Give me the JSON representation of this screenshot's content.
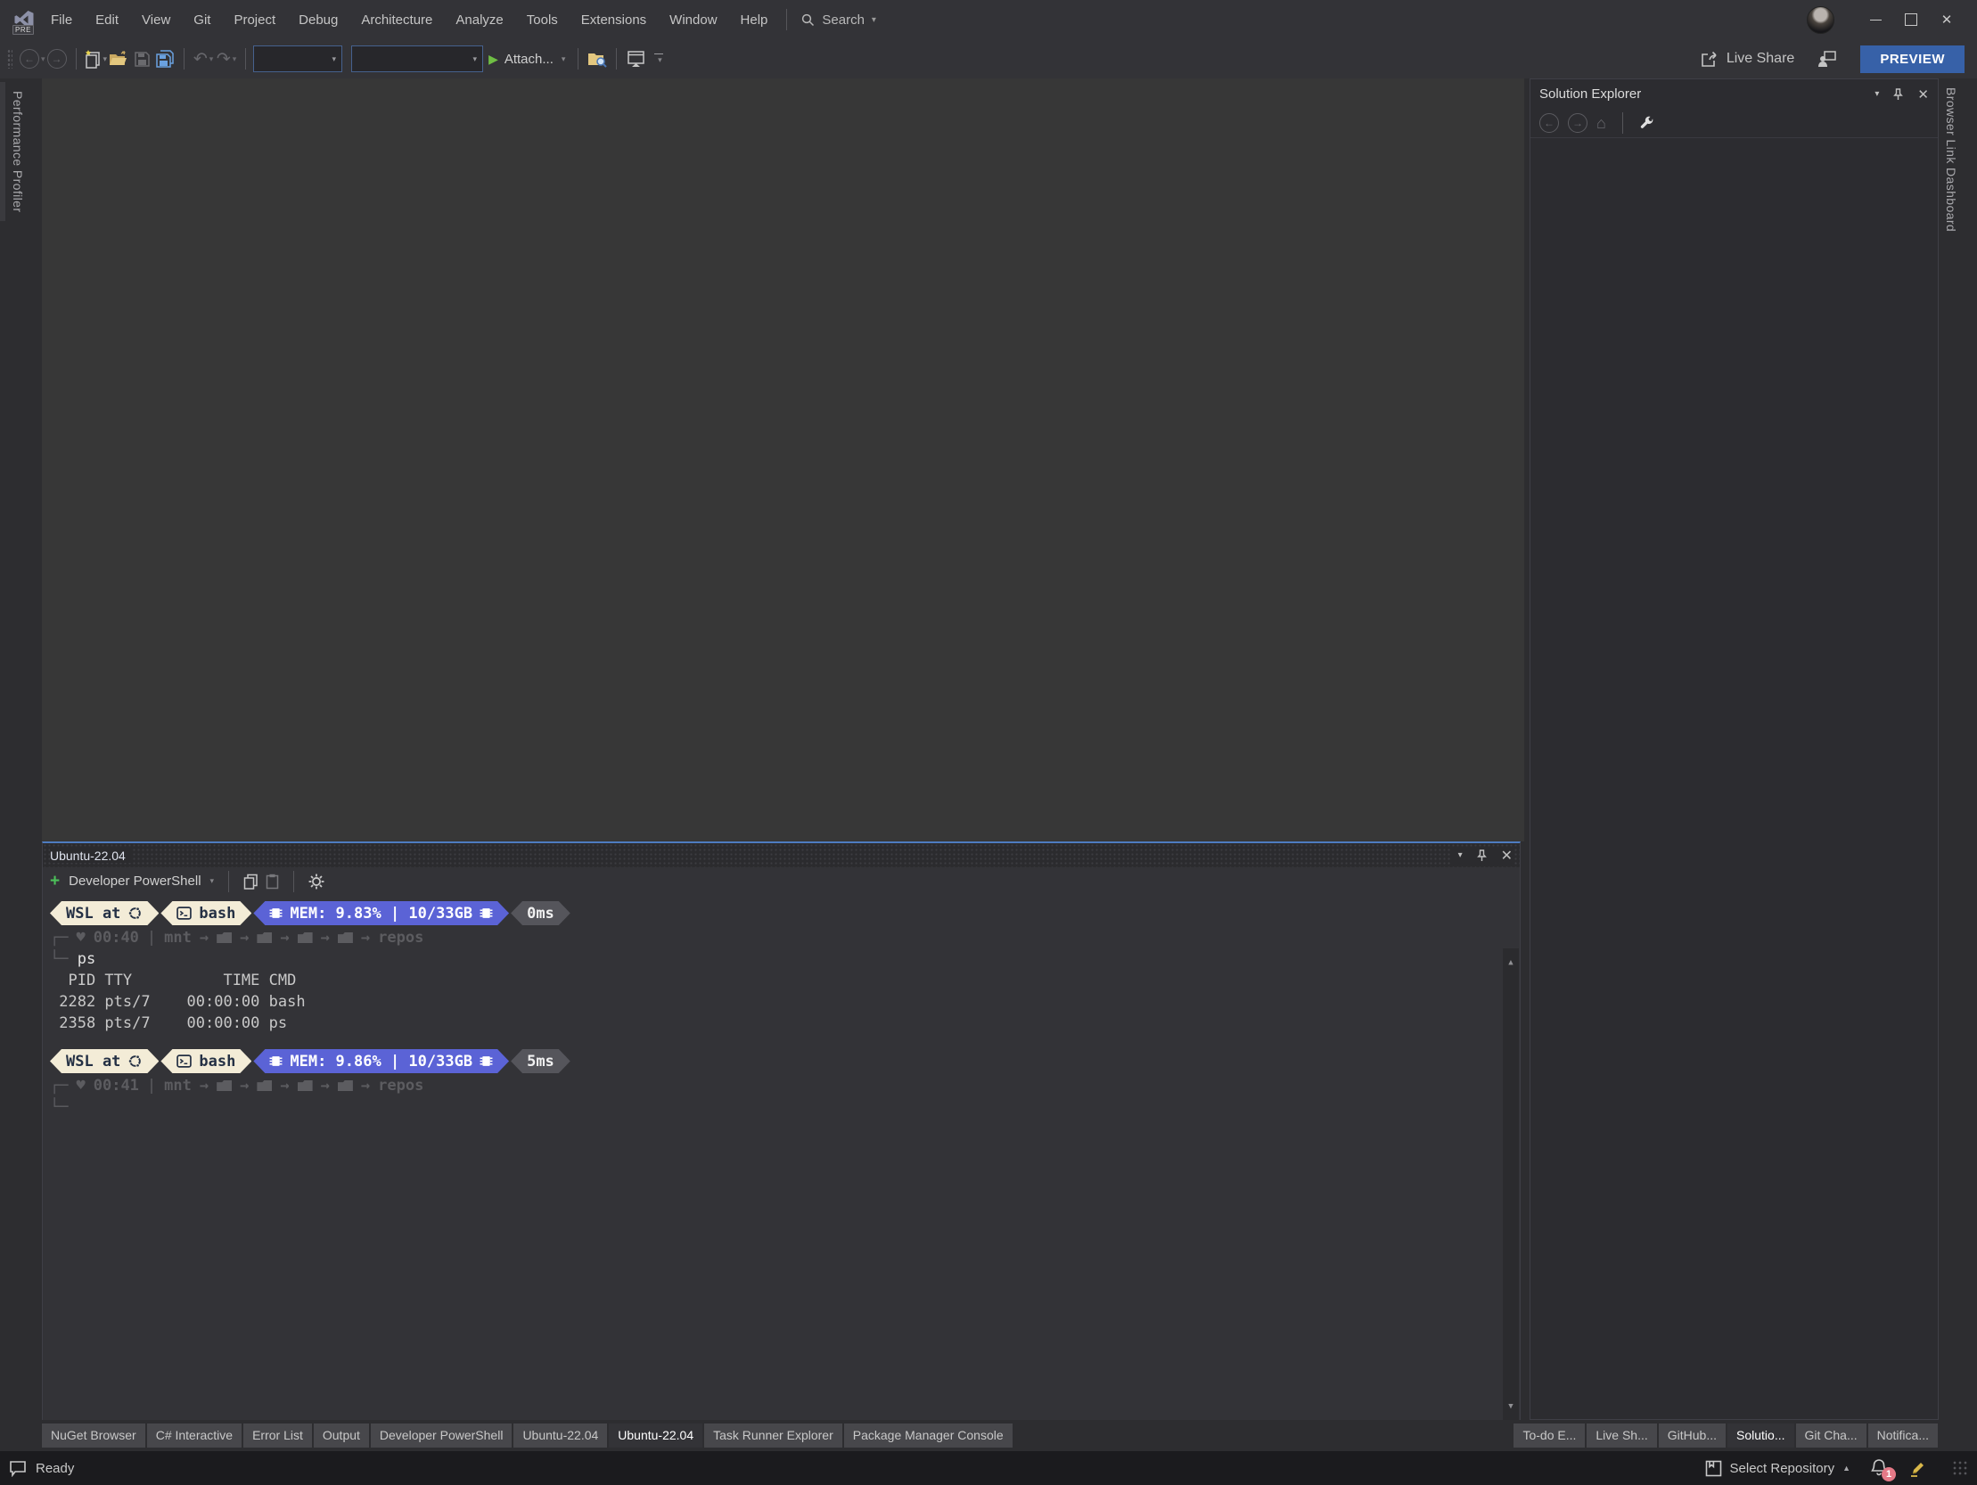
{
  "window": {
    "logo_badge": "PRE"
  },
  "menu": {
    "items": [
      "File",
      "Edit",
      "View",
      "Git",
      "Project",
      "Debug",
      "Architecture",
      "Analyze",
      "Tools",
      "Extensions",
      "Window",
      "Help"
    ],
    "search_label": "Search"
  },
  "toolbar": {
    "attach_label": "Attach..."
  },
  "titlebar_right": {
    "live_share_label": "Live Share",
    "preview_button": "PREVIEW"
  },
  "left_strip": {
    "tab_label": "Performance Profiler"
  },
  "right_strip": {
    "tab_label": "Browser Link Dashboard"
  },
  "solution_explorer": {
    "title": "Solution Explorer"
  },
  "terminal": {
    "title": "Ubuntu-22.04",
    "shell_selector": "Developer PowerShell",
    "block1": {
      "wsl_label": "WSL at",
      "shell_label": "bash",
      "mem_label": "MEM: 9.83% | 10/33GB",
      "time_label": "0ms",
      "clock": "00:40",
      "path_root": "mnt",
      "path_leaf": "repos",
      "command": "ps",
      "output": [
        "  PID TTY          TIME CMD",
        " 2282 pts/7    00:00:00 bash",
        " 2358 pts/7    00:00:00 ps"
      ]
    },
    "block2": {
      "wsl_label": "WSL at",
      "shell_label": "bash",
      "mem_label": "MEM: 9.86% | 10/33GB",
      "time_label": "5ms",
      "clock": "00:41",
      "path_root": "mnt",
      "path_leaf": "repos"
    }
  },
  "bottom_tabs": {
    "left": [
      "NuGet Browser",
      "C# Interactive",
      "Error List",
      "Output",
      "Developer PowerShell",
      "Ubuntu-22.04",
      "Ubuntu-22.04",
      "Task Runner Explorer",
      "Package Manager Console"
    ],
    "right": [
      "To-do E...",
      "Live Sh...",
      "GitHub...",
      "Solutio...",
      "Git Cha...",
      "Notifica..."
    ]
  },
  "status_bar": {
    "ready_label": "Ready",
    "repository_label": "Select Repository",
    "notification_count": "1"
  },
  "glyphs": {
    "corner_top": "┌─",
    "corner_bottom": "└─",
    "pipe": "|",
    "arrow": "→",
    "heart": "♥",
    "caret_down": "▾",
    "caret_up": "▲",
    "close": "✕",
    "back": "←",
    "forward": "→",
    "undo": "↶",
    "redo": "↷",
    "home": "⌂",
    "plus": "+",
    "play": "▶",
    "scroll_up": "▲",
    "scroll_down": "▼"
  },
  "colors": {
    "accent_focus": "#4e7cc0",
    "preview_button": "#3761a8",
    "prompt_cream": "#f3ecd7",
    "prompt_blue": "#5b63d6",
    "prompt_gray": "#55555b",
    "status_badge": "#e57987",
    "add_terminal_green": "#4cc05a"
  }
}
